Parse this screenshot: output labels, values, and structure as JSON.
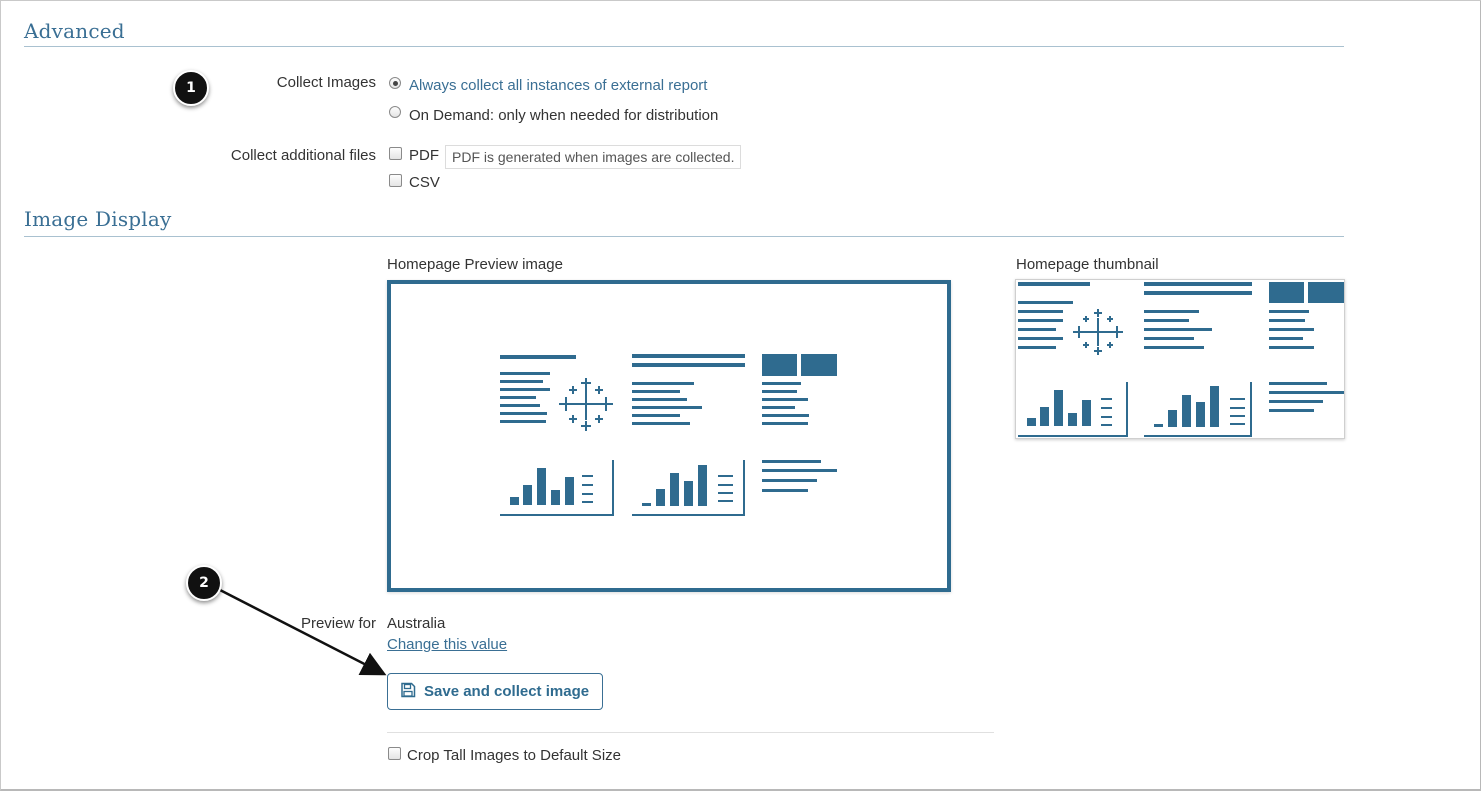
{
  "sections": {
    "advanced": {
      "title": "Advanced"
    },
    "image_display": {
      "title": "Image Display"
    }
  },
  "collect_images": {
    "label": "Collect Images",
    "options": [
      {
        "label": "Always collect all instances of external report",
        "selected": true
      },
      {
        "label": "On Demand: only when needed for distribution",
        "selected": false
      }
    ]
  },
  "additional_files": {
    "label": "Collect additional files",
    "pdf": {
      "label": "PDF",
      "checked": false,
      "hint": "PDF is generated when images are collected."
    },
    "csv": {
      "label": "CSV",
      "checked": false
    }
  },
  "preview": {
    "preview_image_label": "Homepage Preview image",
    "thumbnail_label": "Homepage thumbnail",
    "preview_for_label": "Preview for",
    "preview_for_value": "Australia",
    "change_link": "Change this value",
    "save_button": "Save and collect image",
    "crop_label": "Crop Tall Images to Default Size",
    "crop_checked": false
  },
  "callouts": {
    "first": "1",
    "second": "2"
  },
  "colors": {
    "accent": "#2f6b8f",
    "heading": "#3a6f94",
    "callout": "#111111"
  },
  "icons": {
    "save": "floppy-disk-icon",
    "tableau": "tableau-logo-icon"
  }
}
